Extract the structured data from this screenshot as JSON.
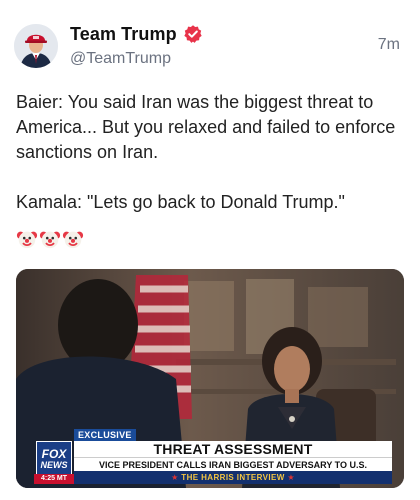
{
  "post": {
    "author": {
      "display_name": "Team Trump",
      "handle": "@TeamTrump",
      "verified": true,
      "avatar_icon": "avatar-profile-photo",
      "verified_color": "#e8334a"
    },
    "timestamp": "7m",
    "text": {
      "paragraph_1": "Baier: You said Iran was the biggest threat to America... But you relaxed and failed to enforce sanctions on Iran.",
      "paragraph_2": "Kamala: \"Lets go back to Donald Trump.\"",
      "emojis": [
        "clown-face-icon",
        "clown-face-icon",
        "clown-face-icon"
      ]
    },
    "media": {
      "type": "video-still",
      "chyron": {
        "tag": "EXCLUSIVE",
        "network_line_1": "FOX",
        "network_line_2": "NEWS",
        "clock": "4:25 MT",
        "headline": "THREAT ASSESSMENT",
        "subheadline": "VICE PRESIDENT CALLS IRAN BIGGEST ADVERSARY TO U.S.",
        "show": "THE HARRIS INTERVIEW",
        "colors": {
          "navy": "#13306e",
          "gold": "#f3c543",
          "red": "#c8102e"
        }
      }
    }
  }
}
